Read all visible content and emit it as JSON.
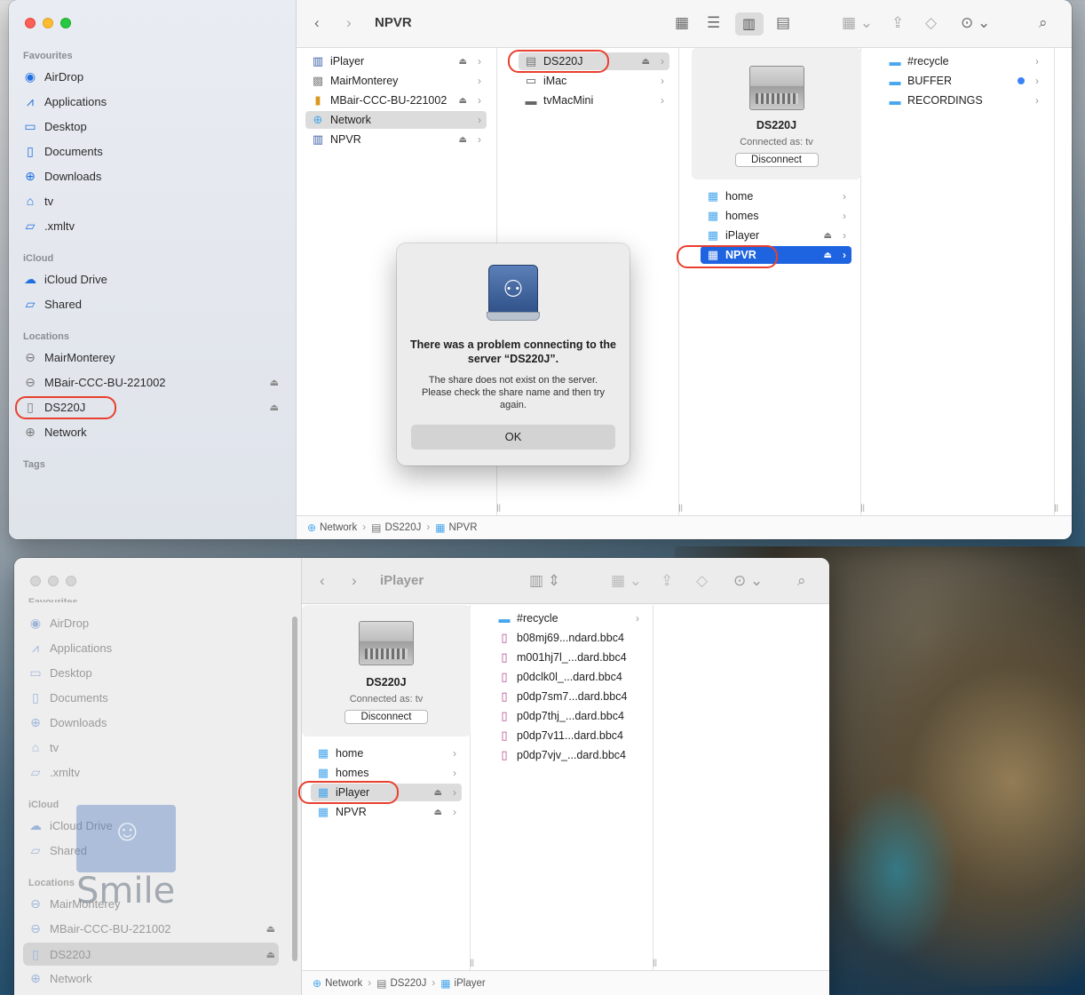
{
  "colors": {
    "accent": "#1e63e0",
    "highlight_ring": "#e8402f",
    "folder": "#47a6ee"
  },
  "window_top": {
    "title": "NPVR",
    "sidebar": {
      "favourites_label": "Favourites",
      "favourites": [
        "AirDrop",
        "Applications",
        "Desktop",
        "Documents",
        "Downloads",
        "tv",
        ".xmltv"
      ],
      "icloud_label": "iCloud",
      "icloud": [
        "iCloud Drive",
        "Shared"
      ],
      "locations_label": "Locations",
      "locations": [
        "MairMonterey",
        "MBair-CCC-BU-221002",
        "DS220J",
        "Network"
      ],
      "tags_label": "Tags"
    },
    "col1": [
      "iPlayer",
      "MairMonterey",
      "MBair-CCC-BU-221002",
      "Network",
      "NPVR"
    ],
    "col2": [
      "DS220J",
      "iMac",
      "tvMacMini"
    ],
    "server": {
      "name": "DS220J",
      "connected": "Connected as: tv",
      "disconnect": "Disconnect"
    },
    "col3": [
      "home",
      "homes",
      "iPlayer",
      "NPVR"
    ],
    "col4": [
      "#recycle",
      "BUFFER",
      "RECORDINGS"
    ],
    "path": [
      "Network",
      "DS220J",
      "NPVR"
    ],
    "dialog": {
      "title": "There was a problem connecting to the server “DS220J”.",
      "message": "The share does not exist on the server. Please check the share name and then try again.",
      "ok": "OK"
    }
  },
  "window_bottom": {
    "title": "iPlayer",
    "sidebar": {
      "favourites_label": "Favourites",
      "favourites": [
        "AirDrop",
        "Applications",
        "Desktop",
        "Documents",
        "Downloads",
        "tv",
        ".xmltv"
      ],
      "icloud_label": "iCloud",
      "icloud": [
        "iCloud Drive",
        "Shared"
      ],
      "locations_label": "Locations",
      "locations": [
        "MairMonterey",
        "MBair-CCC-BU-221002",
        "DS220J",
        "Network"
      ]
    },
    "server": {
      "name": "DS220J",
      "connected": "Connected as: tv",
      "disconnect": "Disconnect"
    },
    "col1": [
      "home",
      "homes",
      "iPlayer",
      "NPVR"
    ],
    "col2": [
      "#recycle",
      "b08mj69...ndard.bbc4",
      "m001hj7l_...dard.bbc4",
      "p0dclk0l_...dard.bbc4",
      "p0dp7sm7...dard.bbc4",
      "p0dp7thj_...dard.bbc4",
      "p0dp7v11...dard.bbc4",
      "p0dp7vjv_...dard.bbc4"
    ],
    "path": [
      "Network",
      "DS220J",
      "iPlayer"
    ]
  },
  "watermark": {
    "word": "Smile"
  }
}
